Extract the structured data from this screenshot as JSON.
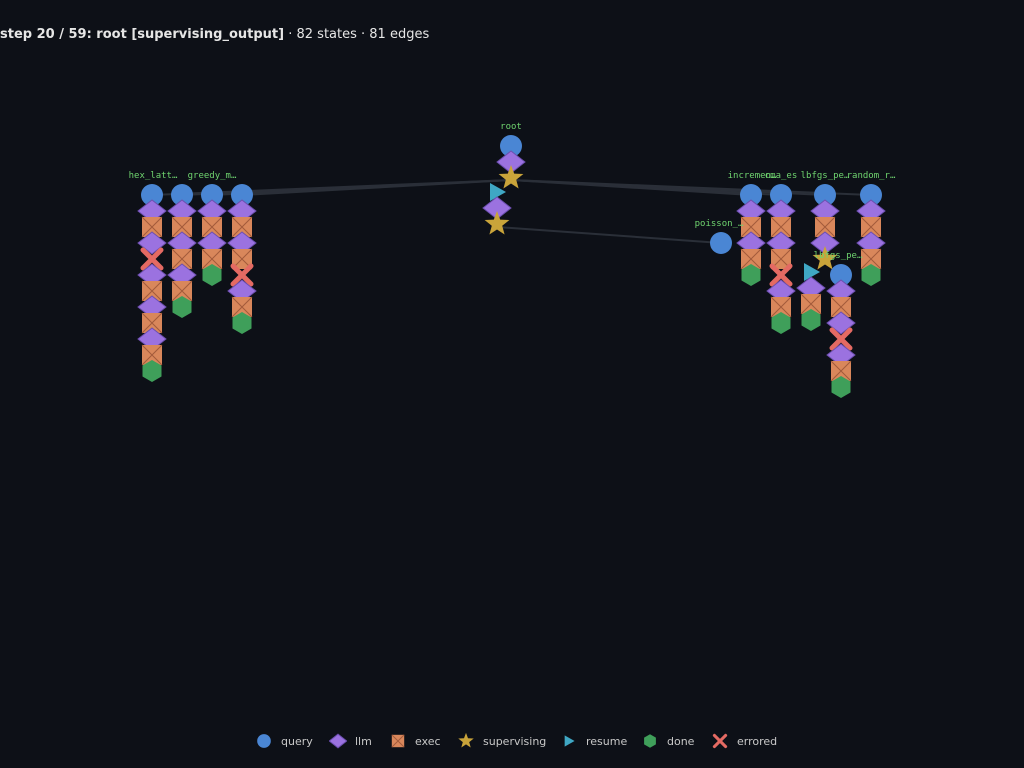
{
  "header": {
    "step": "step 20 / 59: root [supervising_output]",
    "counts": "· 82 states · 81 edges"
  },
  "colors": {
    "query": "#4a86d4",
    "llm": "#9b72e0",
    "exec": "#d9875b",
    "supervising": "#c9a43a",
    "resume": "#3fa7c4",
    "done": "#3f9f5a",
    "errored": "#e46a63",
    "label": "#6fd46f",
    "edge": "#2a2f38"
  },
  "legend": [
    {
      "kind": "query",
      "label": "query"
    },
    {
      "kind": "llm",
      "label": "llm"
    },
    {
      "kind": "exec",
      "label": "exec"
    },
    {
      "kind": "supervising",
      "label": "supervising"
    },
    {
      "kind": "resume",
      "label": "resume"
    },
    {
      "kind": "done",
      "label": "done"
    },
    {
      "kind": "errored",
      "label": "errored"
    }
  ],
  "graph": {
    "labels": [
      {
        "id": "root",
        "text": "root"
      },
      {
        "id": "hex",
        "text": "hex_latt…"
      },
      {
        "id": "greedy",
        "text": "greedy_m…"
      },
      {
        "id": "poisson",
        "text": "poisson_…"
      },
      {
        "id": "incr",
        "text": "incremen…"
      },
      {
        "id": "cma",
        "text": "cma_es"
      },
      {
        "id": "lbfgs",
        "text": "lbfgs_pe…"
      },
      {
        "id": "random",
        "text": "random_r…"
      },
      {
        "id": "lbfgs2",
        "text": "lbfgs_pe…"
      }
    ],
    "columns": [
      {
        "id": "root",
        "states": [
          "query",
          "llm",
          "supervising"
        ]
      },
      {
        "id": "root-resume",
        "states": [
          "resume",
          "llm",
          "supervising"
        ]
      },
      {
        "id": "hex",
        "states": [
          "query",
          "llm",
          "exec",
          "llm",
          "errored",
          "llm",
          "exec",
          "llm",
          "exec",
          "llm",
          "exec",
          "done"
        ]
      },
      {
        "id": "greedy",
        "states": [
          "query",
          "llm",
          "exec",
          "llm",
          "exec",
          "llm",
          "exec",
          "done"
        ]
      },
      {
        "id": "col3",
        "states": [
          "query",
          "llm",
          "exec",
          "llm",
          "exec",
          "done"
        ]
      },
      {
        "id": "col4",
        "states": [
          "query",
          "llm",
          "exec",
          "llm",
          "exec",
          "errored",
          "llm",
          "exec",
          "done"
        ]
      },
      {
        "id": "poisson",
        "states": [
          "query"
        ]
      },
      {
        "id": "incr",
        "states": [
          "query",
          "llm",
          "exec",
          "llm",
          "exec",
          "done"
        ]
      },
      {
        "id": "cma",
        "states": [
          "query",
          "llm",
          "exec",
          "llm",
          "exec",
          "errored",
          "llm",
          "exec",
          "done"
        ]
      },
      {
        "id": "lbfgs",
        "states": [
          "query",
          "llm",
          "exec",
          "llm",
          "supervising"
        ]
      },
      {
        "id": "lbfgs-resume",
        "states": [
          "resume",
          "llm",
          "exec",
          "done"
        ]
      },
      {
        "id": "lbfgs2",
        "states": [
          "query",
          "llm",
          "exec",
          "llm",
          "errored",
          "llm",
          "exec",
          "done"
        ]
      },
      {
        "id": "random",
        "states": [
          "query",
          "llm",
          "exec",
          "llm",
          "exec",
          "done"
        ]
      }
    ]
  }
}
